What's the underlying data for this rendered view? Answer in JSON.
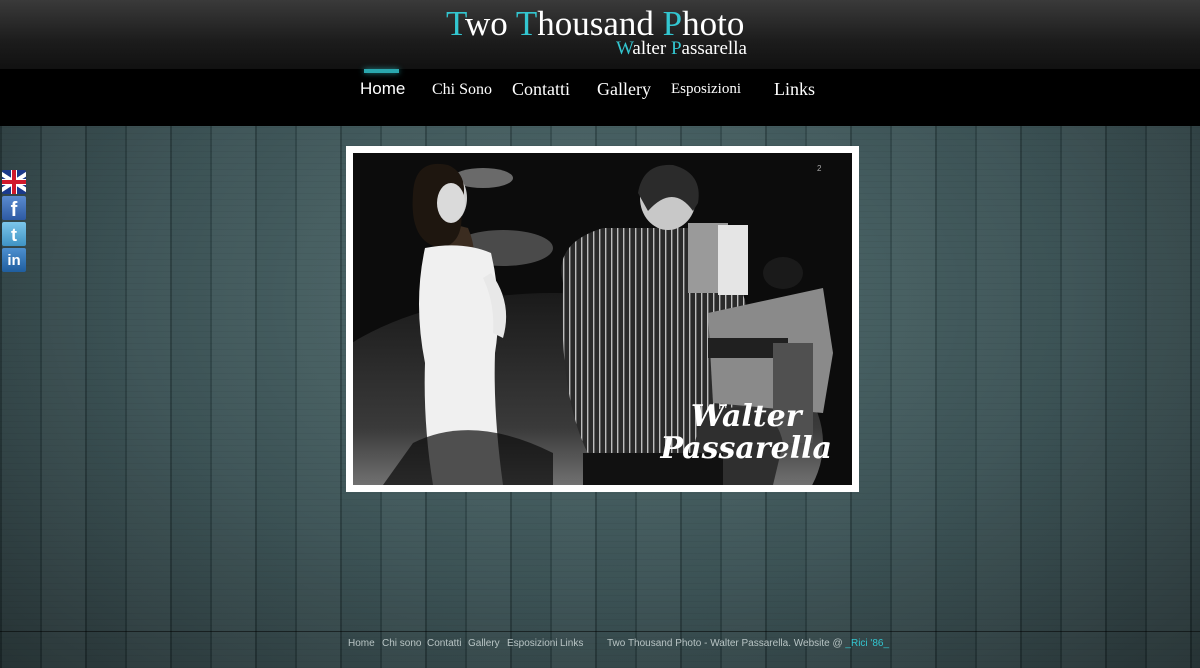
{
  "header": {
    "title_parts": [
      {
        "cap": "T",
        "rest": "wo "
      },
      {
        "cap": "T",
        "rest": "housand "
      },
      {
        "cap": "P",
        "rest": "hoto"
      }
    ],
    "subtitle_parts": [
      {
        "cap": "W",
        "rest": "alter "
      },
      {
        "cap": "P",
        "rest": "assarella"
      }
    ],
    "accent_color": "#33c6d0"
  },
  "nav": {
    "items": [
      {
        "label": "Home",
        "active": true
      },
      {
        "label": "Chi Sono",
        "active": false
      },
      {
        "label": "Contatti",
        "active": false
      },
      {
        "label": "Gallery",
        "active": false
      },
      {
        "label": "Esposizioni",
        "active": false
      },
      {
        "label": "Links",
        "active": false
      }
    ]
  },
  "social": {
    "items": [
      {
        "icon": "uk-flag-icon"
      },
      {
        "icon": "facebook-icon",
        "glyph": "f"
      },
      {
        "icon": "twitter-icon",
        "glyph": "t"
      },
      {
        "icon": "linkedin-icon",
        "glyph": "in"
      }
    ]
  },
  "photo": {
    "signature_line1": "Walter",
    "signature_line2": "Passarella",
    "photo_number": "2"
  },
  "footer": {
    "links": [
      "Home",
      "Chi sono",
      "Contatti",
      "Gallery",
      "Esposizioni",
      "Links"
    ],
    "credit_text": "Two Thousand Photo - Walter Passarella. Website @",
    "credit_author": "_Rici '86_"
  }
}
